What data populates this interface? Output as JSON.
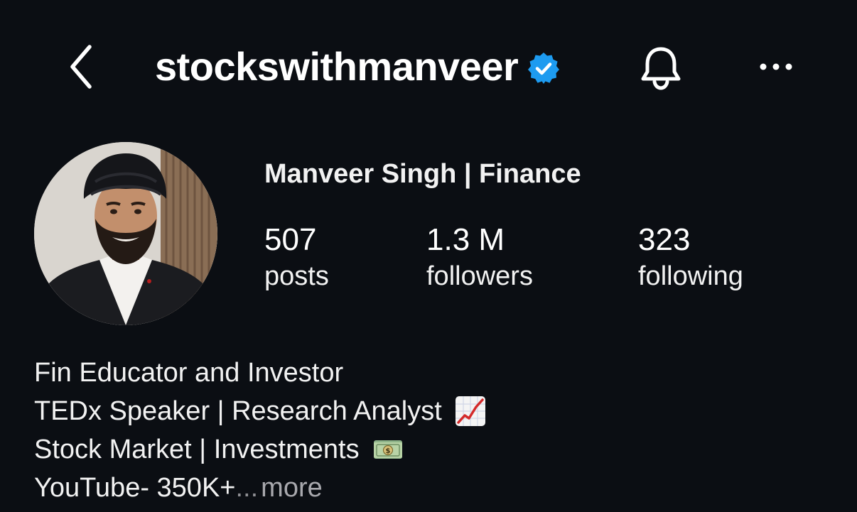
{
  "header": {
    "username": "stockswithmanveer",
    "verified_icon": "verified-badge-icon",
    "back_icon": "chevron-left-icon",
    "bell_icon": "bell-icon",
    "more_icon": "more-horizontal-icon",
    "verified_color": "#1d9bf0"
  },
  "profile": {
    "display_name": "Manveer Singh | Finance",
    "stats": {
      "posts": {
        "value": "507",
        "label": "posts"
      },
      "followers": {
        "value": "1.3 M",
        "label": "followers"
      },
      "following": {
        "value": "323",
        "label": "following"
      }
    }
  },
  "bio": {
    "lines": [
      "Fin Educator and Investor",
      "TEDx Speaker | Research Analyst",
      "Stock Market | Investments",
      "YouTube- 350K+"
    ],
    "line2_emoji": "chart-increasing-icon",
    "line3_emoji": "dollar-banknote-icon",
    "ellipsis": "...",
    "more_label": "more"
  },
  "colors": {
    "background": "#0b0e13",
    "text": "#ffffff",
    "muted": "#a8a8ad"
  }
}
